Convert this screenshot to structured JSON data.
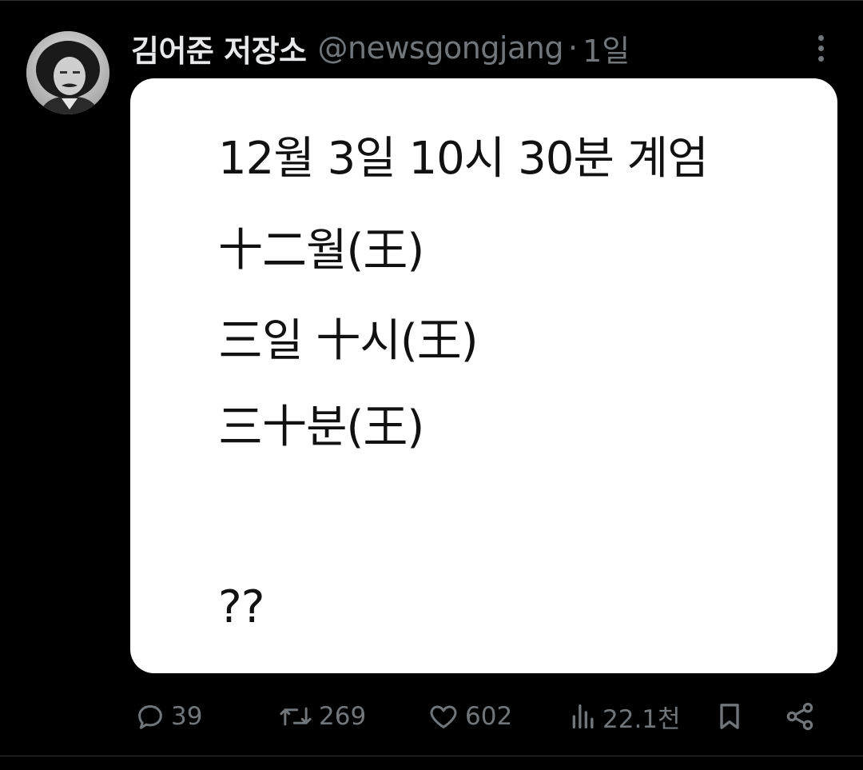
{
  "post": {
    "author": {
      "display_name": "김어준 저장소",
      "handle": "@newsgongjang",
      "separator": "·",
      "time": "1일",
      "avatar_icon": "profile-photo"
    },
    "more_icon": "more-vertical-icon",
    "media": {
      "lines": [
        "12월 3일 10시 30분 계엄",
        "十二월(王)",
        "三일 十시(王)",
        "三十분(王)",
        "??"
      ]
    },
    "actions": {
      "reply": {
        "icon": "reply-icon",
        "count": "39"
      },
      "repost": {
        "icon": "repost-icon",
        "count": "269"
      },
      "like": {
        "icon": "heart-icon",
        "count": "602"
      },
      "views": {
        "icon": "views-icon",
        "count": "22.1천"
      },
      "bookmark": {
        "icon": "bookmark-icon"
      },
      "share": {
        "icon": "share-icon"
      }
    }
  },
  "colors": {
    "background": "#000000",
    "primary_text": "#e7e9ea",
    "secondary_text": "#71767b",
    "divider": "#2f3336",
    "card": "#ffffff"
  }
}
